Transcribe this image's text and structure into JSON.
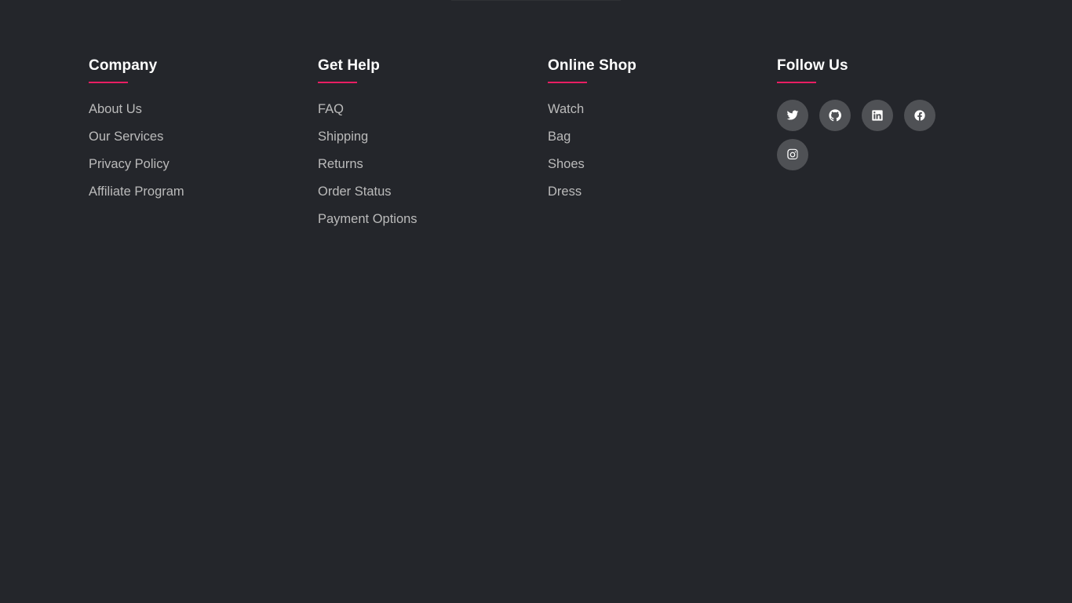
{
  "footer": {
    "company": {
      "title": "Company",
      "links": [
        "About Us",
        "Our Services",
        "Privacy Policy",
        "Affiliate Program"
      ]
    },
    "help": {
      "title": "Get Help",
      "links": [
        "FAQ",
        "Shipping",
        "Returns",
        "Order Status",
        "Payment Options"
      ]
    },
    "shop": {
      "title": "Online Shop",
      "links": [
        "Watch",
        "Bag",
        "Shoes",
        "Dress"
      ]
    },
    "follow": {
      "title": "Follow Us",
      "icons": [
        "twitter-icon",
        "github-icon",
        "linkedin-icon",
        "facebook-icon",
        "instagram-icon"
      ]
    }
  },
  "colors": {
    "background": "#24262b",
    "accent": "#e91e63",
    "heading": "#ffffff",
    "link": "#bbbbbb",
    "social_bg": "rgba(255,255,255,0.2)"
  }
}
